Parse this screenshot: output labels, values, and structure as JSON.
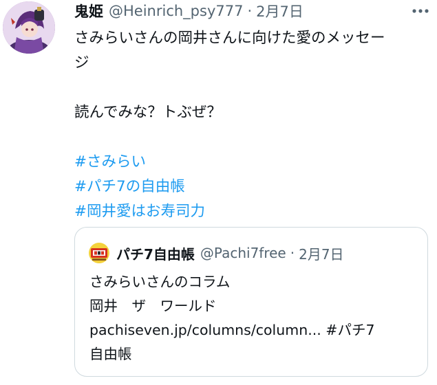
{
  "tweet": {
    "display_name": "鬼姫",
    "handle": "@Heinrich_psy777",
    "separator": "·",
    "date": "2月7日",
    "more_icon": "more-horizontal-icon",
    "lines": [
      "さみらいさんの岡井さんに向けた愛のメッセー",
      "ジ",
      "",
      "読んでみな？トぶぜ？",
      ""
    ],
    "hashtags": [
      "#さみらい",
      "#パチ7の自由帳",
      "#岡井愛はお寿司力"
    ]
  },
  "quote": {
    "display_name": "パチ7自由帳",
    "handle": "@Pachi7free",
    "separator": "·",
    "date": "2月7日",
    "lines": [
      "さみらいさんのコラム",
      "岡井　ザ　ワールド"
    ],
    "link_text": "pachiseven.jp/columns/column...",
    "hashtag": "#パチ7",
    "last_line": "自由帳"
  },
  "colors": {
    "text": "#0f1419",
    "secondary": "#536471",
    "link": "#1d9bf0",
    "border": "#cfd9de"
  }
}
